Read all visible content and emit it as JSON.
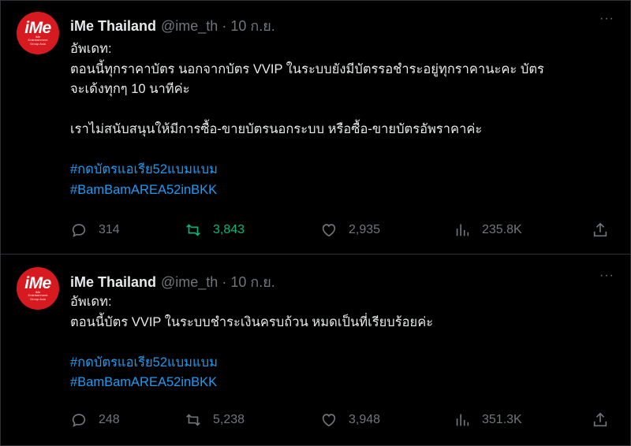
{
  "tweets": [
    {
      "account": {
        "name": "iMe Thailand",
        "handle": "@ime_th",
        "separator": "·",
        "date": "10 ก.ย.",
        "avatar_logo": "iMe",
        "avatar_sub": "iMe Entertainment Group Asia"
      },
      "more_label": "···",
      "lines": [
        "อัพเดท:",
        "ตอนนี้ทุกราคาบัตร นอกจากบัตร VVIP ในระบบยังมีบัตรรอชำระอยู่ทุกราคานะคะ บัตร",
        "จะเด้งทุกๆ 10 นาทีค่ะ",
        "",
        "เราไม่สนับสนุนให้มีการซื้อ-ขายบัตรนอกระบบ หรือซื้อ-ขายบัตรอัพราคาค่ะ",
        ""
      ],
      "hashtags": [
        "#กดบัตรแอเรีย52แบมแบม",
        "#BamBamAREA52inBKK"
      ],
      "stats": {
        "replies": "314",
        "retweets": "3,843",
        "likes": "2,935",
        "views": "235.8K"
      },
      "retweeted": true
    },
    {
      "account": {
        "name": "iMe Thailand",
        "handle": "@ime_th",
        "separator": "·",
        "date": "10 ก.ย.",
        "avatar_logo": "iMe",
        "avatar_sub": "iMe Entertainment Group Asia"
      },
      "more_label": "···",
      "lines": [
        "อัพเดท:",
        "ตอนนี้บัตร VVIP ในระบบชำระเงินครบถ้วน หมดเป็นที่เรียบร้อยค่ะ",
        ""
      ],
      "hashtags": [
        "#กดบัตรแอเรีย52แบมแบม",
        "#BamBamAREA52inBKK"
      ],
      "stats": {
        "replies": "248",
        "retweets": "5,238",
        "likes": "3,948",
        "views": "351.3K"
      },
      "retweeted": false
    }
  ],
  "colors": {
    "background": "#000000",
    "text": "#e7e9ea",
    "muted": "#71767b",
    "link": "#1d9bf0",
    "retweet_active": "#00ba7c",
    "avatar": "#d71920"
  },
  "icons": [
    "reply-icon",
    "retweet-icon",
    "like-icon",
    "views-icon",
    "share-icon",
    "more-icon"
  ]
}
